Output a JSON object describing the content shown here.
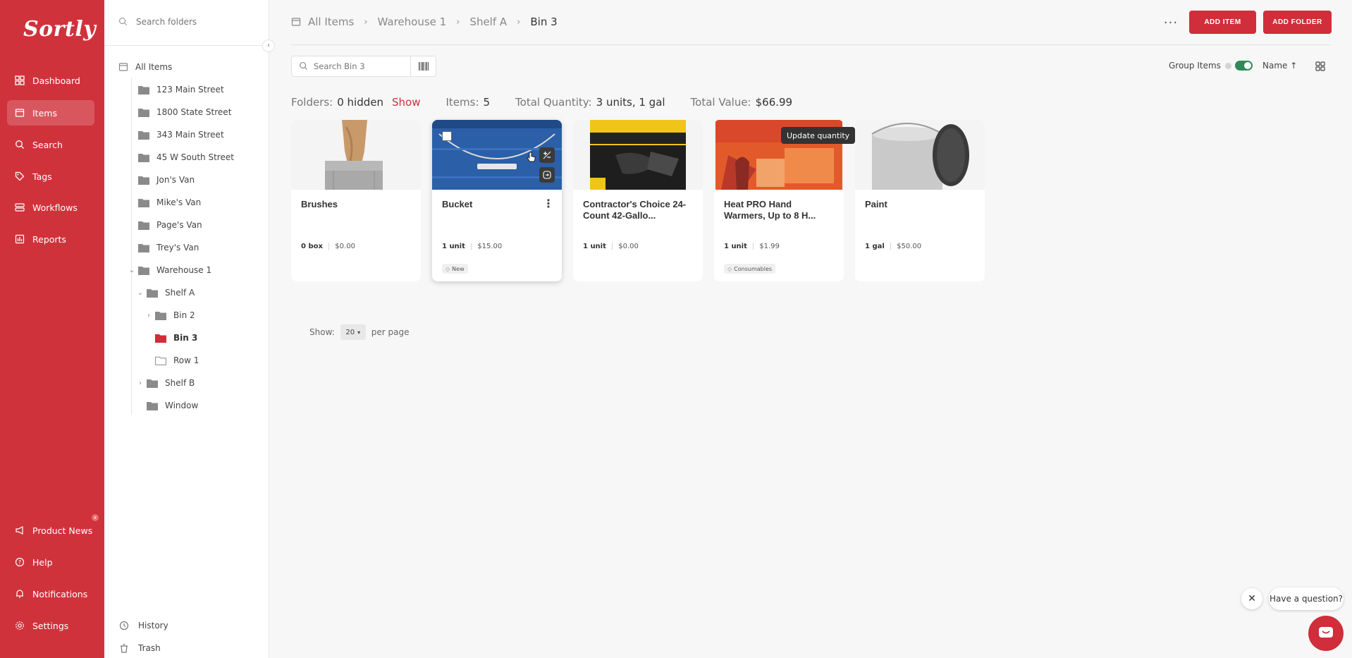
{
  "brand": {
    "logo": "Sortly",
    "accent": "#cf2e3a",
    "nav_bg": "#d0323c"
  },
  "nav": {
    "top": [
      {
        "label": "Dashboard",
        "icon": "dashboard-icon"
      },
      {
        "label": "Items",
        "icon": "items-icon",
        "active": true
      },
      {
        "label": "Search",
        "icon": "search-icon"
      },
      {
        "label": "Tags",
        "icon": "tag-icon"
      },
      {
        "label": "Workflows",
        "icon": "workflows-icon"
      },
      {
        "label": "Reports",
        "icon": "reports-icon"
      }
    ],
    "bottom": [
      {
        "label": "Product News",
        "icon": "megaphone-icon"
      },
      {
        "label": "Help",
        "icon": "help-icon"
      },
      {
        "label": "Notifications",
        "icon": "bell-icon"
      },
      {
        "label": "Settings",
        "icon": "gear-icon"
      }
    ]
  },
  "folder_panel": {
    "search_placeholder": "Search folders",
    "tree": [
      {
        "label": "All Items"
      },
      {
        "label": "123 Main Street"
      },
      {
        "label": "1800 State Street"
      },
      {
        "label": "343 Main Street"
      },
      {
        "label": "45 W South Street"
      },
      {
        "label": "Jon's Van"
      },
      {
        "label": "Mike's Van"
      },
      {
        "label": "Page's Van"
      },
      {
        "label": "Trey's Van"
      },
      {
        "label": "Warehouse 1"
      },
      {
        "label": "Shelf A"
      },
      {
        "label": "Bin 2"
      },
      {
        "label": "Bin 3"
      },
      {
        "label": "Row 1"
      },
      {
        "label": "Shelf B"
      },
      {
        "label": "Window"
      }
    ],
    "history_label": "History",
    "trash_label": "Trash"
  },
  "header": {
    "breadcrumb": [
      "All Items",
      "Warehouse 1",
      "Shelf A",
      "Bin 3"
    ],
    "more_label": "...",
    "add_item_label": "ADD ITEM",
    "add_folder_label": "ADD FOLDER"
  },
  "toolbar": {
    "search_placeholder": "Search Bin 3",
    "group_items_label": "Group Items",
    "group_items_on": true,
    "sort_label": "Name",
    "sort_arrow": "↑"
  },
  "summary": {
    "folders_label": "Folders:",
    "folders_value": "0 hidden",
    "show_label": "Show",
    "items_label": "Items:",
    "items_value": "5",
    "total_qty_label": "Total Quantity:",
    "total_qty_value": "3 units, 1 gal",
    "total_value_label": "Total Value:",
    "total_value_value": "$66.99"
  },
  "items": [
    {
      "name": "Brushes",
      "qty": "0 box",
      "price": "$0.00",
      "tag": ""
    },
    {
      "name": "Bucket",
      "qty": "1 unit",
      "price": "$15.00",
      "tag": "New"
    },
    {
      "name": "Contractor's Choice 24-Count 42-Gallo...",
      "qty": "1 unit",
      "price": "$0.00",
      "tag": ""
    },
    {
      "name": "Heat PRO Hand Warmers, Up to 8 H...",
      "qty": "1 unit",
      "price": "$1.99",
      "tag": "Consumables"
    },
    {
      "name": "Paint",
      "qty": "1 gal",
      "price": "$50.00",
      "tag": ""
    }
  ],
  "tooltip": "Update quantity",
  "pagination": {
    "show_label": "Show:",
    "per_page_value": "20",
    "per_page_label": "per page"
  },
  "chat": {
    "close_label": "✕",
    "bubble_text": "Have a question?"
  },
  "product_news_badge": "x"
}
